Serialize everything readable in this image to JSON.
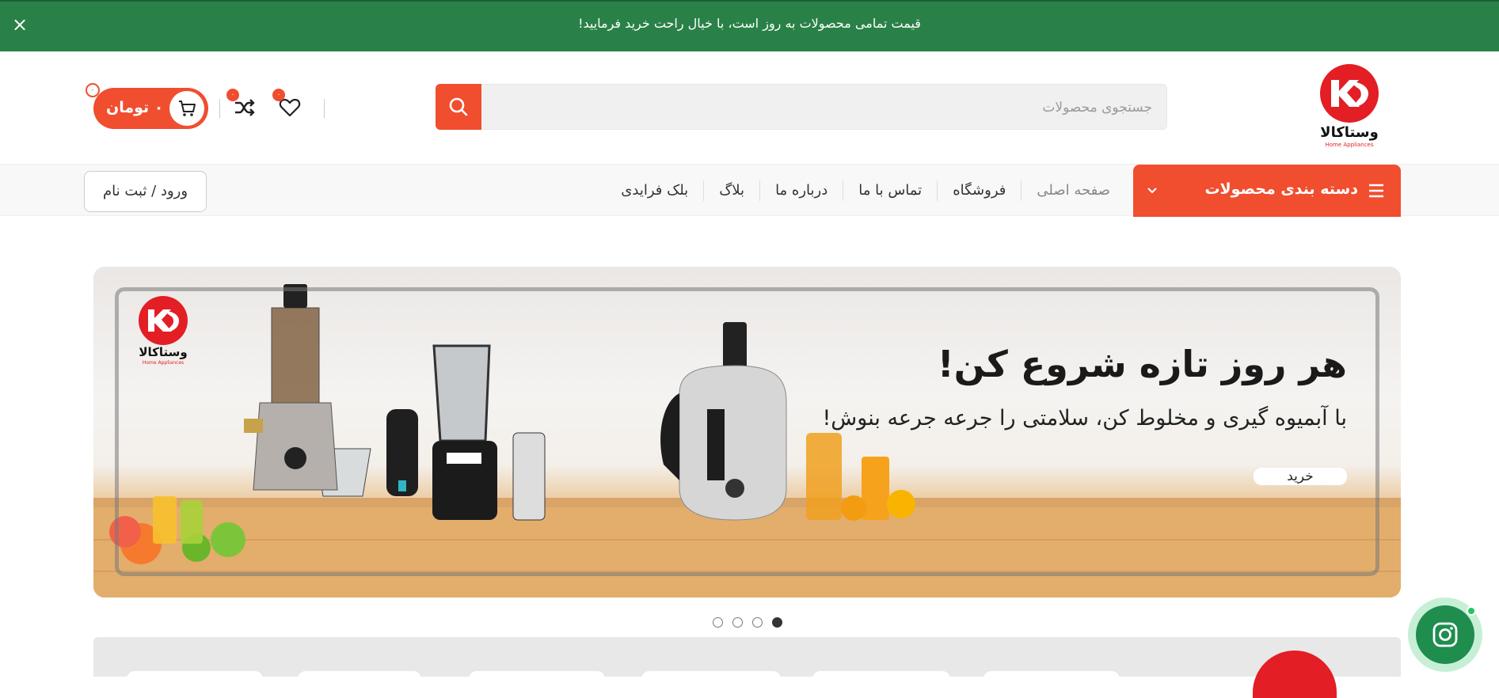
{
  "topbar": {
    "message": "قیمت تمامی محصولات به روز است، با خیال راحت خرید فرمایید!",
    "close_label": "×"
  },
  "header": {
    "logo_text": "وستاکالا",
    "logo_sub": "Home Appliances",
    "search_placeholder": "جستجوی محصولات",
    "cart_label": "۰ تومان",
    "cart_count": "۰",
    "wishlist_count": "۰",
    "compare_count": "۰",
    "accent": "#f04e2f"
  },
  "nav": {
    "category_label": "دسته بندی محصولات",
    "links": [
      "صفحه اصلی",
      "فروشگاه",
      "تماس با ما",
      "درباره ما",
      "بلاگ",
      "بلک فرایدی"
    ],
    "login_label": "ورود / ثبت نام"
  },
  "banner": {
    "headline": "هر روز تازه شروع کن!",
    "subtitle": "با آبمیوه گیری و مخلوط کن، سلامتی را جرعه جرعه بنوش!",
    "button_label": "خرید",
    "slides": 4,
    "active_slide": 1
  },
  "colors": {
    "topbar": "#2a8148",
    "accent": "#f04e2f",
    "instagram": "#1e8d4e"
  }
}
